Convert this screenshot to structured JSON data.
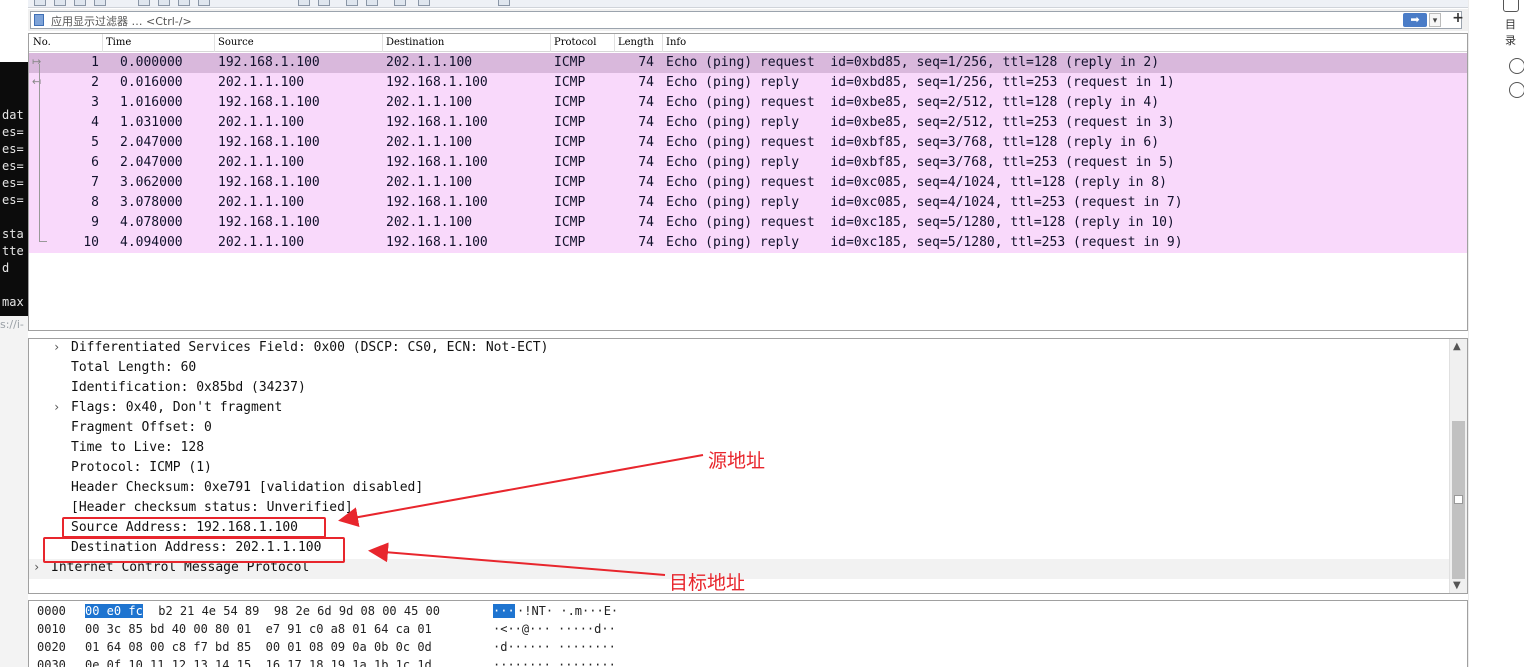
{
  "filter": {
    "placeholder": "应用显示过滤器 … <Ctrl-/>",
    "apply_icon": "arrow-right-icon",
    "add_label": "+"
  },
  "packet_list": {
    "columns": [
      "No.",
      "Time",
      "Source",
      "Destination",
      "Protocol",
      "Length",
      "Info"
    ],
    "rows": [
      {
        "no": "1",
        "time": "0.000000",
        "src": "192.168.1.100",
        "dst": "202.1.1.100",
        "proto": "ICMP",
        "len": "74",
        "info": "Echo (ping) request  id=0xbd85, seq=1/256, ttl=128 (reply in 2)"
      },
      {
        "no": "2",
        "time": "0.016000",
        "src": "202.1.1.100",
        "dst": "192.168.1.100",
        "proto": "ICMP",
        "len": "74",
        "info": "Echo (ping) reply    id=0xbd85, seq=1/256, ttl=253 (request in 1)"
      },
      {
        "no": "3",
        "time": "1.016000",
        "src": "192.168.1.100",
        "dst": "202.1.1.100",
        "proto": "ICMP",
        "len": "74",
        "info": "Echo (ping) request  id=0xbe85, seq=2/512, ttl=128 (reply in 4)"
      },
      {
        "no": "4",
        "time": "1.031000",
        "src": "202.1.1.100",
        "dst": "192.168.1.100",
        "proto": "ICMP",
        "len": "74",
        "info": "Echo (ping) reply    id=0xbe85, seq=2/512, ttl=253 (request in 3)"
      },
      {
        "no": "5",
        "time": "2.047000",
        "src": "192.168.1.100",
        "dst": "202.1.1.100",
        "proto": "ICMP",
        "len": "74",
        "info": "Echo (ping) request  id=0xbf85, seq=3/768, ttl=128 (reply in 6)"
      },
      {
        "no": "6",
        "time": "2.047000",
        "src": "202.1.1.100",
        "dst": "192.168.1.100",
        "proto": "ICMP",
        "len": "74",
        "info": "Echo (ping) reply    id=0xbf85, seq=3/768, ttl=253 (request in 5)"
      },
      {
        "no": "7",
        "time": "3.062000",
        "src": "192.168.1.100",
        "dst": "202.1.1.100",
        "proto": "ICMP",
        "len": "74",
        "info": "Echo (ping) request  id=0xc085, seq=4/1024, ttl=128 (reply in 8)"
      },
      {
        "no": "8",
        "time": "3.078000",
        "src": "202.1.1.100",
        "dst": "192.168.1.100",
        "proto": "ICMP",
        "len": "74",
        "info": "Echo (ping) reply    id=0xc085, seq=4/1024, ttl=253 (request in 7)"
      },
      {
        "no": "9",
        "time": "4.078000",
        "src": "192.168.1.100",
        "dst": "202.1.1.100",
        "proto": "ICMP",
        "len": "74",
        "info": "Echo (ping) request  id=0xc185, seq=5/1280, ttl=128 (reply in 10)"
      },
      {
        "no": "10",
        "time": "4.094000",
        "src": "202.1.1.100",
        "dst": "192.168.1.100",
        "proto": "ICMP",
        "len": "74",
        "info": "Echo (ping) reply    id=0xc185, seq=5/1280, ttl=253 (request in 9)"
      }
    ]
  },
  "details": [
    {
      "expand": "›",
      "text": "Differentiated Services Field: 0x00 (DSCP: CS0, ECN: Not-ECT)"
    },
    {
      "expand": "",
      "text": "Total Length: 60"
    },
    {
      "expand": "",
      "text": "Identification: 0x85bd (34237)"
    },
    {
      "expand": "›",
      "text": "Flags: 0x40, Don't fragment"
    },
    {
      "expand": "",
      "text": "Fragment Offset: 0"
    },
    {
      "expand": "",
      "text": "Time to Live: 128"
    },
    {
      "expand": "",
      "text": "Protocol: ICMP (1)"
    },
    {
      "expand": "",
      "text": "Header Checksum: 0xe791 [validation disabled]"
    },
    {
      "expand": "",
      "text": "[Header checksum status: Unverified]"
    },
    {
      "expand": "",
      "text": "Source Address: 192.168.1.100"
    },
    {
      "expand": "",
      "text": "Destination Address: 202.1.1.100"
    },
    {
      "expand": "›",
      "text": "Internet Control Message Protocol"
    }
  ],
  "hex": [
    {
      "offset": "0000",
      "sel": "00 e0 fc",
      "rest": " b2 21 4e 54 89  98 2e 6d 9d 08 00 45 00",
      "ascii_sel": "···",
      "ascii_rest": "·!NT· ·.m···E·"
    },
    {
      "offset": "0010",
      "sel": "",
      "rest": "00 3c 85 bd 40 00 80 01  e7 91 c0 a8 01 64 ca 01",
      "ascii_sel": "",
      "ascii_rest": "·<··@··· ·····d··"
    },
    {
      "offset": "0020",
      "sel": "",
      "rest": "01 64 08 00 c8 f7 bd 85  00 01 08 09 0a 0b 0c 0d",
      "ascii_sel": "",
      "ascii_rest": "·d······ ········"
    },
    {
      "offset": "0030",
      "sel": "",
      "rest": "0e 0f 10 11 12 13 14 15  16 17 18 19 1a 1b 1c 1d",
      "ascii_sel": "",
      "ascii_rest": "········ ········"
    }
  ],
  "annotations": {
    "source": "源地址",
    "destination": "目标地址"
  },
  "terminal": {
    "lines": [
      "dat",
      "es=",
      "es=",
      "es=",
      "es=",
      "es=",
      "sta",
      "tte",
      "d",
      "max"
    ],
    "url": "s://i-"
  },
  "side_panel": {
    "label": "目录"
  },
  "colors": {
    "row_bg": "#f9d9fb",
    "row_selected": "#d9b8dc",
    "annotation": "#e8262d",
    "hex_highlight": "#1e74d0"
  }
}
